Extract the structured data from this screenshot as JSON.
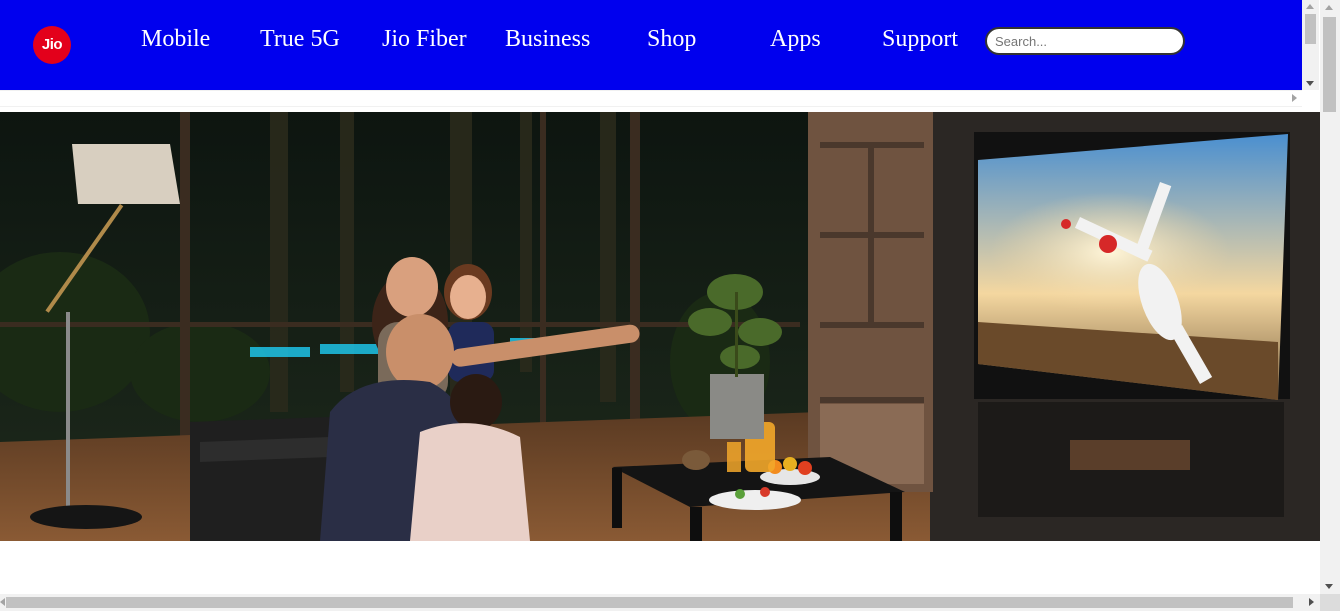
{
  "brand": {
    "logo_text": "Jio",
    "primary_color": "#0000ee",
    "logo_color": "#e3001b"
  },
  "nav": {
    "items": [
      {
        "label": "Mobile"
      },
      {
        "label": "True 5G"
      },
      {
        "label": "Jio Fiber"
      },
      {
        "label": "Business"
      },
      {
        "label": "Shop"
      },
      {
        "label": "Apps"
      },
      {
        "label": "Support"
      }
    ]
  },
  "search": {
    "placeholder": "Search...",
    "value": ""
  },
  "hero": {
    "image_alt": "Family cheering while watching cricket on a wall-mounted TV in a living room"
  }
}
